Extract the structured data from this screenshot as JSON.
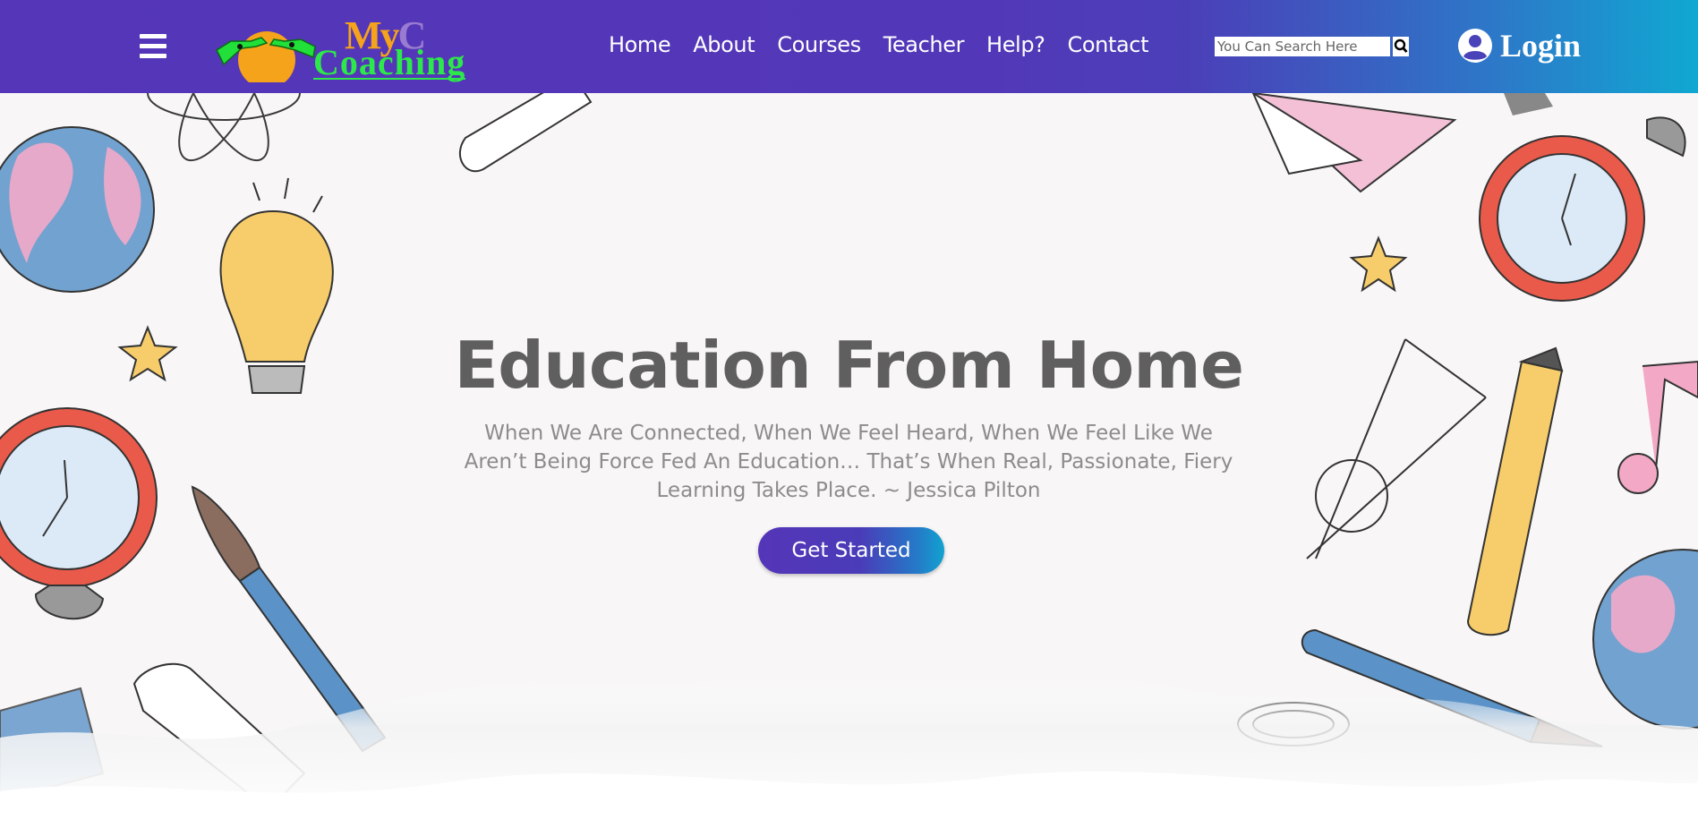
{
  "header": {
    "logo": {
      "line1": "My",
      "line1_ghost": "C",
      "line2": "Coaching"
    },
    "nav": [
      "Home",
      "About",
      "Courses",
      "Teacher",
      "Help?",
      "Contact"
    ],
    "search": {
      "placeholder": "You Can Search Here"
    },
    "login_label": "Login"
  },
  "hero": {
    "title": "Education From Home",
    "quote": "When We Are Connected, When We Feel Heard, When We Feel Like We Aren’t Being Force Fed An Education… That’s When Real, Passionate, Fiery Learning Takes Place. ~ Jessica Pilton",
    "cta_label": "Get Started"
  },
  "colors": {
    "header_start": "#5535b8",
    "header_end": "#10a8d2",
    "logo_orange": "#f5a31a",
    "logo_green": "#2de84a",
    "title_gray": "#5f5f5f",
    "quote_gray": "#8c8c8c"
  },
  "icons": [
    "hamburger-menu-icon",
    "logo-hands-icon",
    "search-icon",
    "user-circle-icon"
  ]
}
